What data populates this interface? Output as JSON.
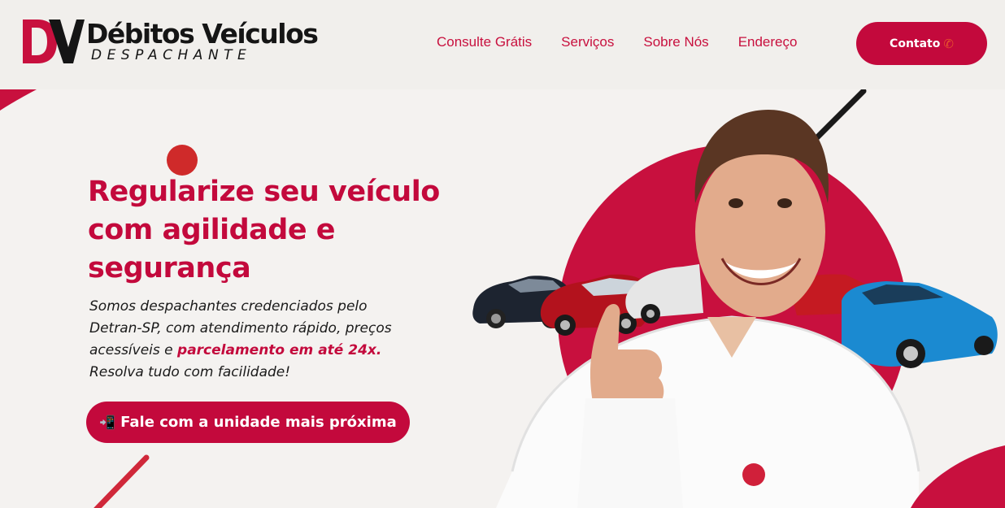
{
  "brand": {
    "mark": "DV",
    "title": "Débitos Veículos",
    "subtitle": "DESPACHANTE"
  },
  "nav": {
    "items": [
      {
        "label": "Consulte Grátis"
      },
      {
        "label": "Serviços"
      },
      {
        "label": "Sobre Nós"
      },
      {
        "label": "Endereço"
      }
    ]
  },
  "contact_button": {
    "label": "Contato",
    "icon": "phone-icon"
  },
  "hero": {
    "headline_line1": "Regularize seu veículo",
    "headline_line2": "com agilidade e",
    "headline_line3": "segurança",
    "desc_part1": "Somos despachantes credenciados pelo Detran-SP, com atendimento rápido, preços acessíveis e ",
    "desc_highlight": "parcelamento em até 24x.",
    "desc_part2": " Resolva tudo com facilidade!",
    "cta_label": "Fale com a unidade mais próxima",
    "cta_icon": "mobile-phone-icon"
  },
  "colors": {
    "brand_red": "#c3093c",
    "nav_red": "#c8103e",
    "header_bg": "#f1efec",
    "text_dark": "#151515"
  }
}
